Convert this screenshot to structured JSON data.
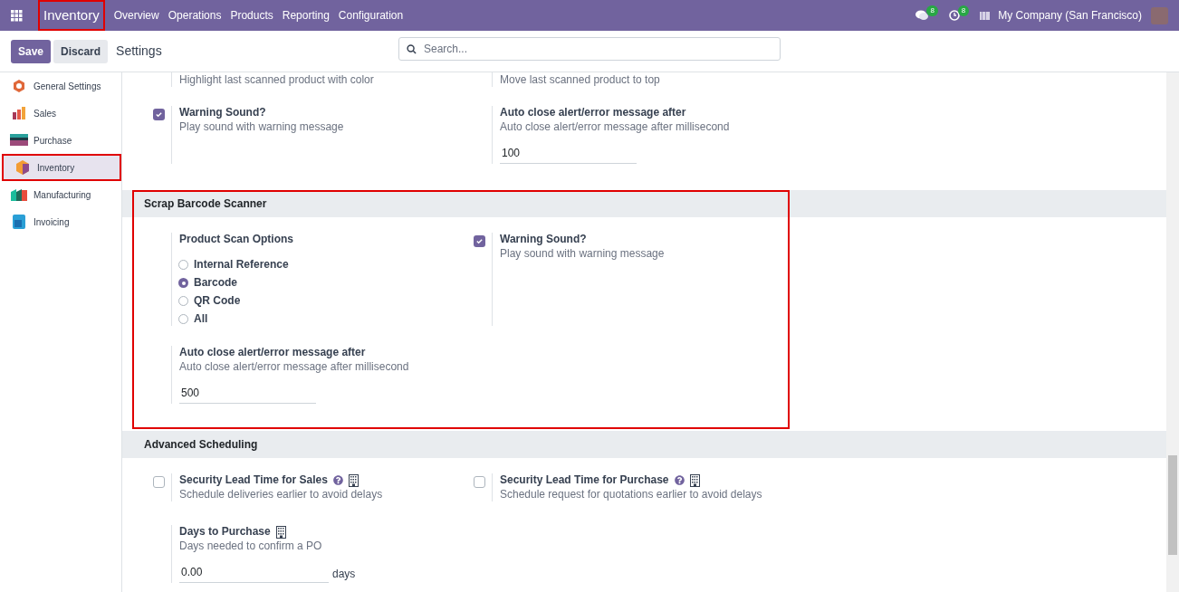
{
  "navbar": {
    "app": {
      "label": "Inventory",
      "highlighted": true
    },
    "menu": [
      "Overview",
      "Operations",
      "Products",
      "Reporting",
      "Configuration"
    ],
    "messages_count": "8",
    "activities_count": "8",
    "company": "My Company (San Francisco)"
  },
  "control_bar": {
    "buttons": [
      {
        "label": "Save",
        "kind": "primary"
      },
      {
        "label": "Discard",
        "kind": "secondary"
      }
    ],
    "title": "Settings",
    "search": {
      "placeholder": "Search..."
    }
  },
  "sidebar": {
    "items": [
      {
        "label": "General Settings",
        "selected": false,
        "highlighted": false
      },
      {
        "label": "Sales",
        "selected": false,
        "highlighted": false
      },
      {
        "label": "Purchase",
        "selected": false,
        "highlighted": false
      },
      {
        "label": "Inventory",
        "selected": true,
        "highlighted": true
      },
      {
        "label": "Manufacturing",
        "selected": false,
        "highlighted": false
      },
      {
        "label": "Invoicing",
        "selected": false,
        "highlighted": false
      }
    ]
  },
  "sections": [
    {
      "rows": [
        [
          {
            "kind": "plain",
            "description": "Highlight last scanned product with color"
          },
          {
            "kind": "plain",
            "description": "Move last scanned product to top"
          }
        ],
        [
          {
            "kind": "checkbox",
            "title": "Warning Sound?",
            "description": "Play sound with warning message",
            "checked": true
          },
          {
            "kind": "field",
            "title": "Auto close alert/error message after",
            "description": "Auto close alert/error message after millisecond",
            "value": "100"
          }
        ]
      ]
    },
    {
      "title": "Scrap Barcode Scanner",
      "highlighted": true,
      "rows": [
        [
          {
            "kind": "radio",
            "title": "Product Scan Options",
            "options": [
              {
                "label": "Internal Reference",
                "selected": false
              },
              {
                "label": "Barcode",
                "selected": true
              },
              {
                "label": "QR Code",
                "selected": false
              },
              {
                "label": "All",
                "selected": false
              }
            ]
          },
          {
            "kind": "checkbox",
            "title": "Warning Sound?",
            "description": "Play sound with warning message",
            "checked": true
          }
        ],
        [
          {
            "kind": "field",
            "title": "Auto close alert/error message after",
            "description": "Auto close alert/error message after millisecond",
            "value": "500"
          }
        ]
      ]
    },
    {
      "title": "Advanced Scheduling",
      "rows": [
        [
          {
            "kind": "checkbox",
            "title": "Security Lead Time for Sales",
            "description": "Schedule deliveries earlier to avoid delays",
            "checked": false,
            "help": true,
            "company": true
          },
          {
            "kind": "checkbox",
            "title": "Security Lead Time for Purchase",
            "description": "Schedule request for quotations earlier to avoid delays",
            "checked": false,
            "help": true,
            "company": true
          }
        ],
        [
          {
            "kind": "field",
            "title": "Days to Purchase",
            "description": "Days needed to confirm a PO",
            "value": "0.00",
            "unit": "days",
            "company": true
          }
        ]
      ]
    }
  ]
}
